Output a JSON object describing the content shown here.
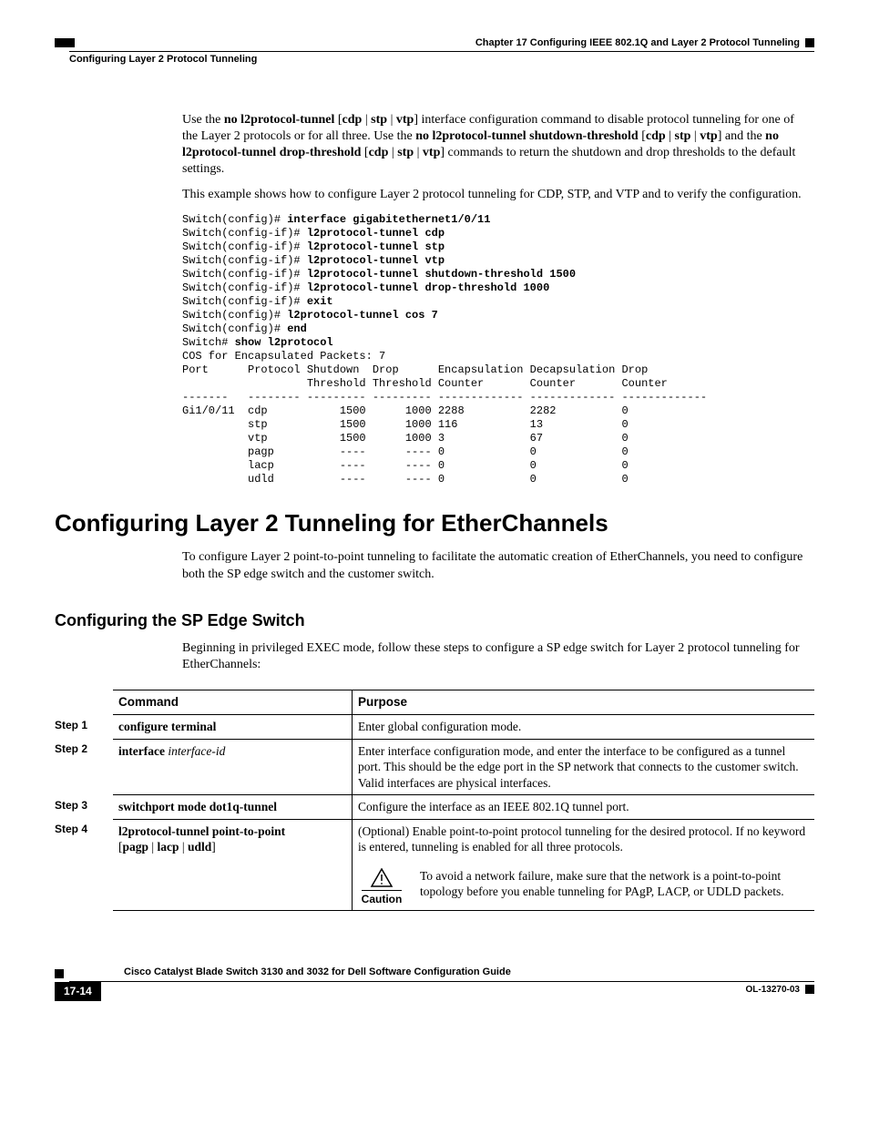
{
  "header": {
    "chapter": "Chapter 17      Configuring IEEE 802.1Q and Layer 2 Protocol Tunneling",
    "left": "Configuring Layer 2 Protocol Tunneling"
  },
  "para1": {
    "t1": "Use the ",
    "b1": "no l2protocol-tunnel",
    "t2": " [",
    "b2": "cdp",
    "t3": " | ",
    "b3": "stp",
    "t4": " | ",
    "b4": "vtp",
    "t5": "] interface configuration command to disable protocol tunneling for one of the Layer 2 protocols or for all three. Use the ",
    "b5": "no l2protocol-tunnel shutdown-threshold",
    "t6": " [",
    "b6": "cdp",
    "t7": " | ",
    "b7": "stp",
    "t8": " | ",
    "b8": "vtp",
    "t9": "] and the ",
    "b9": "no l2protocol-tunnel drop-threshold",
    "t10": " [",
    "b10": "cdp",
    "t11": " | ",
    "b11": "stp",
    "t12": " | ",
    "b12": "vtp",
    "t13": "] commands to return the shutdown and drop thresholds to the default settings."
  },
  "para2": "This example shows how to configure Layer 2 protocol tunneling for CDP, STP, and VTP and to verify the configuration.",
  "code": "Switch(config)# interface gigabitethernet1/0/11\nSwitch(config-if)# l2protocol-tunnel cdp\nSwitch(config-if)# l2protocol-tunnel stp\nSwitch(config-if)# l2protocol-tunnel vtp\nSwitch(config-if)# l2protocol-tunnel shutdown-threshold 1500\nSwitch(config-if)# l2protocol-tunnel drop-threshold 1000\nSwitch(config-if)# exit\nSwitch(config)# l2protocol-tunnel cos 7\nSwitch(config)# end\nSwitch# show l2protocol\nCOS for Encapsulated Packets: 7\nPort      Protocol Shutdown  Drop      Encapsulation Decapsulation Drop\n                   Threshold Threshold Counter       Counter       Counter\n-------   -------- --------- --------- ------------- ------------- -------------\nGi1/0/11  cdp           1500      1000 2288          2282          0\n          stp           1500      1000 116           13            0\n          vtp           1500      1000 3             67            0\n          pagp          ----      ---- 0             0             0\n          lacp          ----      ---- 0             0             0\n          udld          ----      ---- 0             0             0",
  "h1": "Configuring Layer 2 Tunneling for EtherChannels",
  "h1_p": "To configure Layer 2 point-to-point tunneling to facilitate the automatic creation of EtherChannels, you need to configure both the SP edge switch and the customer switch.",
  "h2": "Configuring the SP Edge Switch",
  "h2_p": "Beginning in privileged EXEC mode, follow these steps to configure a SP edge switch for Layer 2 protocol tunneling for EtherChannels:",
  "table": {
    "headers": {
      "command": "Command",
      "purpose": "Purpose"
    },
    "steps": [
      {
        "step": "Step 1",
        "command_b": "configure terminal",
        "command_i": "",
        "purpose": "Enter global configuration mode."
      },
      {
        "step": "Step 2",
        "command_b": "interface",
        "command_i": " interface-id",
        "purpose": "Enter interface configuration mode, and enter the interface to be configured as a tunnel port. This should be the edge port in the SP network that connects to the customer switch. Valid interfaces are physical interfaces."
      },
      {
        "step": "Step 3",
        "command_b": "switchport mode dot1q-tunnel",
        "command_i": "",
        "purpose": "Configure the interface as an IEEE 802.1Q tunnel port."
      },
      {
        "step": "Step 4",
        "command_b": "l2protocol-tunnel point-to-point",
        "command_b2": "pagp",
        "command_sep1": " | ",
        "command_b3": "lacp",
        "command_sep2": " | ",
        "command_b4": "udld",
        "purpose": "(Optional) Enable point-to-point protocol tunneling for the desired protocol. If no keyword is entered, tunneling is enabled for all three protocols.",
        "caution_label": "Caution",
        "caution": "To avoid a network failure, make sure that the network is a point-to-point topology before you enable tunneling for PAgP, LACP, or UDLD packets."
      }
    ]
  },
  "footer": {
    "title": "Cisco Catalyst Blade Switch 3130 and 3032 for Dell Software Configuration Guide",
    "page": "17-14",
    "docid": "OL-13270-03"
  }
}
